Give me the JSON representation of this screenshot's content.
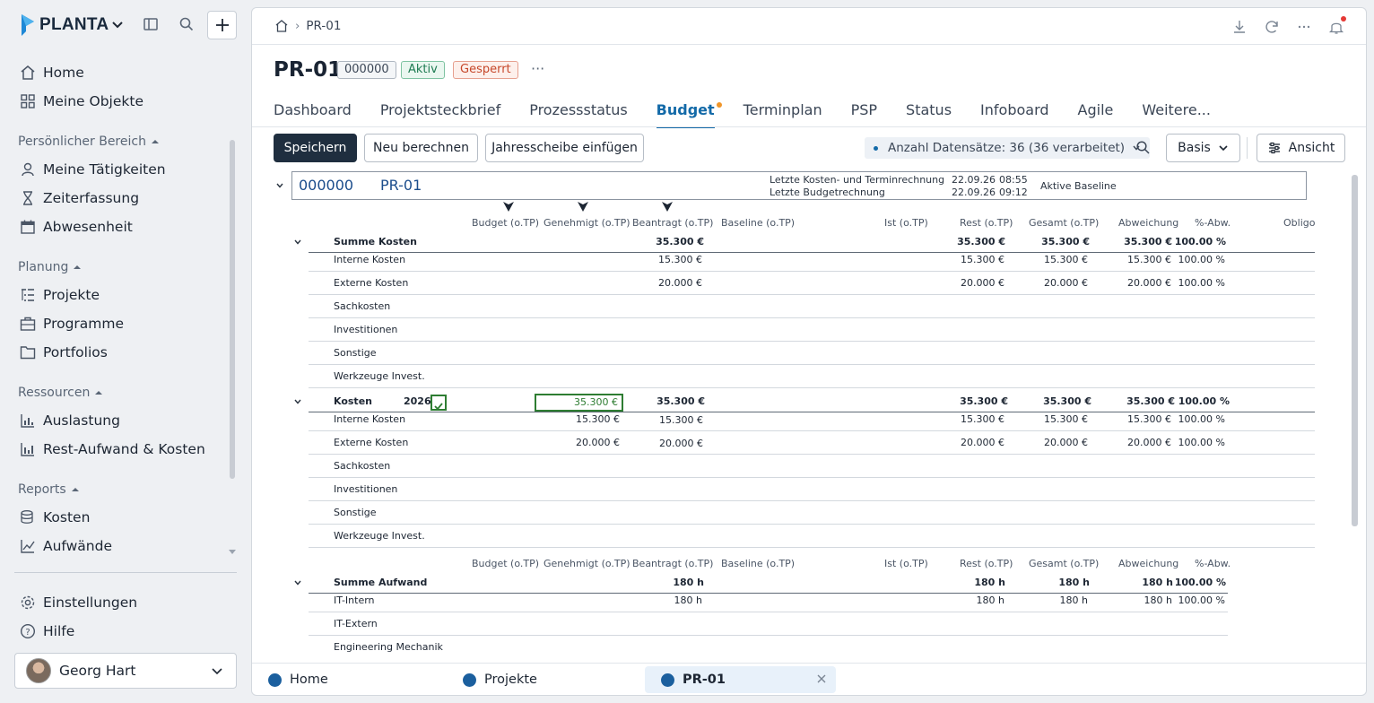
{
  "app": {
    "brand": "PLANTA"
  },
  "sidebar": {
    "main_items": [
      {
        "label": "Home",
        "icon": "home-icon"
      },
      {
        "label": "Meine Objekte",
        "icon": "grid-icon"
      }
    ],
    "sections": [
      {
        "title": "Persönlicher Bereich",
        "items": [
          {
            "label": "Meine Tätigkeiten",
            "icon": "person-icon"
          },
          {
            "label": "Zeiterfassung",
            "icon": "hourglass-icon"
          },
          {
            "label": "Abwesenheit",
            "icon": "calendar-icon"
          }
        ]
      },
      {
        "title": "Planung",
        "items": [
          {
            "label": "Projekte",
            "icon": "list-tree-icon"
          },
          {
            "label": "Programme",
            "icon": "briefcase-icon"
          },
          {
            "label": "Portfolios",
            "icon": "folder-icon"
          }
        ]
      },
      {
        "title": "Ressourcen",
        "items": [
          {
            "label": "Auslastung",
            "icon": "bar-chart-icon"
          },
          {
            "label": "Rest-Aufwand & Kosten",
            "icon": "bar-chart-icon"
          }
        ]
      },
      {
        "title": "Reports",
        "items": [
          {
            "label": "Kosten",
            "icon": "coins-icon"
          },
          {
            "label": "Aufwände",
            "icon": "trend-icon"
          }
        ]
      }
    ],
    "footer_items": [
      {
        "label": "Einstellungen",
        "icon": "gear-icon"
      },
      {
        "label": "Hilfe",
        "icon": "help-icon"
      }
    ],
    "user": {
      "name": "Georg Hart"
    }
  },
  "header": {
    "breadcrumb": "PR-01",
    "title": "PR-01",
    "badge_id": "000000",
    "badge_status": "Aktiv",
    "badge_lock": "Gesperrt",
    "more": "···"
  },
  "tabs": [
    {
      "label": "Dashboard",
      "active": false
    },
    {
      "label": "Projektsteckbrief",
      "active": false
    },
    {
      "label": "Prozessstatus",
      "active": false
    },
    {
      "label": "Budget",
      "active": true
    },
    {
      "label": "Terminplan",
      "active": false
    },
    {
      "label": "PSP",
      "active": false
    },
    {
      "label": "Status",
      "active": false
    },
    {
      "label": "Infoboard",
      "active": false
    },
    {
      "label": "Agile",
      "active": false
    },
    {
      "label": "Weitere...",
      "active": false
    }
  ],
  "toolbar": {
    "save": "Speichern",
    "recalc": "Neu berechnen",
    "insert_year": "Jahresscheibe einfügen",
    "records": "Anzahl Datensätze: 36 (36 verarbeitet)",
    "basis": "Basis",
    "view": "Ansicht"
  },
  "grid": {
    "project_code": "000000",
    "project_name": "PR-01",
    "calc_cost_label": "Letzte Kosten- und Terminrechnung",
    "calc_cost_date": "22.09.26",
    "calc_cost_time": "08:55",
    "calc_budget_label": "Letzte Budgetrechnung",
    "calc_budget_date": "22.09.26",
    "calc_budget_time": "09:12",
    "baseline_label": "Aktive Baseline",
    "columns": [
      "Budget (o.TP)",
      "Genehmigt (o.TP)",
      "Beantragt (o.TP)",
      "Baseline (o.TP)",
      "Ist (o.TP)",
      "Rest (o.TP)",
      "Gesamt (o.TP)",
      "Abweichung",
      "%-Abw.",
      "Obligo"
    ],
    "summe_kosten": {
      "label": "Summe Kosten",
      "beantragt": "35.300 €",
      "rest": "35.300 €",
      "gesamt": "35.300 €",
      "abweichung": "35.300 €",
      "pabw": "100.00 %",
      "rows": [
        {
          "label": "Interne Kosten",
          "beantragt": "15.300 €",
          "rest": "15.300 €",
          "gesamt": "15.300 €",
          "abweichung": "15.300 €",
          "pabw": "100.00 %"
        },
        {
          "label": "Externe Kosten",
          "beantragt": "20.000 €",
          "rest": "20.000 €",
          "gesamt": "20.000 €",
          "abweichung": "20.000 €",
          "pabw": "100.00 %"
        },
        {
          "label": "Sachkosten"
        },
        {
          "label": "Investitionen"
        },
        {
          "label": "Sonstige"
        },
        {
          "label": "Werkzeuge Invest."
        }
      ]
    },
    "kosten_year": {
      "label": "Kosten",
      "year": "2026",
      "genehmigt": "35.300 €",
      "beantragt": "35.300 €",
      "rest": "35.300 €",
      "gesamt": "35.300 €",
      "abweichung": "35.300 €",
      "pabw": "100.00 %",
      "rows": [
        {
          "label": "Interne Kosten",
          "genehmigt": "15.300 €",
          "beantragt": "15.300 €",
          "rest": "15.300 €",
          "gesamt": "15.300 €",
          "abweichung": "15.300 €",
          "pabw": "100.00 %"
        },
        {
          "label": "Externe Kosten",
          "genehmigt": "20.000 €",
          "beantragt": "20.000 €",
          "rest": "20.000 €",
          "gesamt": "20.000 €",
          "abweichung": "20.000 €",
          "pabw": "100.00 %"
        },
        {
          "label": "Sachkosten"
        },
        {
          "label": "Investitionen"
        },
        {
          "label": "Sonstige"
        },
        {
          "label": "Werkzeuge Invest."
        }
      ]
    },
    "columns2": [
      "Budget (o.TP)",
      "Genehmigt (o.TP)",
      "Beantragt (o.TP)",
      "Baseline (o.TP)",
      "Ist (o.TP)",
      "Rest (o.TP)",
      "Gesamt (o.TP)",
      "Abweichung",
      "%-Abw."
    ],
    "summe_aufwand": {
      "label": "Summe Aufwand",
      "beantragt": "180 h",
      "rest": "180 h",
      "gesamt": "180 h",
      "abweichung": "180 h",
      "pabw": "100.00 %",
      "rows": [
        {
          "label": "IT-Intern",
          "beantragt": "180 h",
          "rest": "180 h",
          "gesamt": "180 h",
          "abweichung": "180 h",
          "pabw": "100.00 %"
        },
        {
          "label": "IT-Extern"
        },
        {
          "label": "Engineering Mechanik"
        }
      ]
    }
  },
  "taskbar": [
    {
      "label": "Home",
      "active": false
    },
    {
      "label": "Projekte",
      "active": false
    },
    {
      "label": "PR-01",
      "active": true
    }
  ],
  "colors": {
    "accent": "#136aa8",
    "primary_button": "#1f2e3f",
    "tab_dot": "#f0962a",
    "edit_green": "#2e7d32"
  }
}
